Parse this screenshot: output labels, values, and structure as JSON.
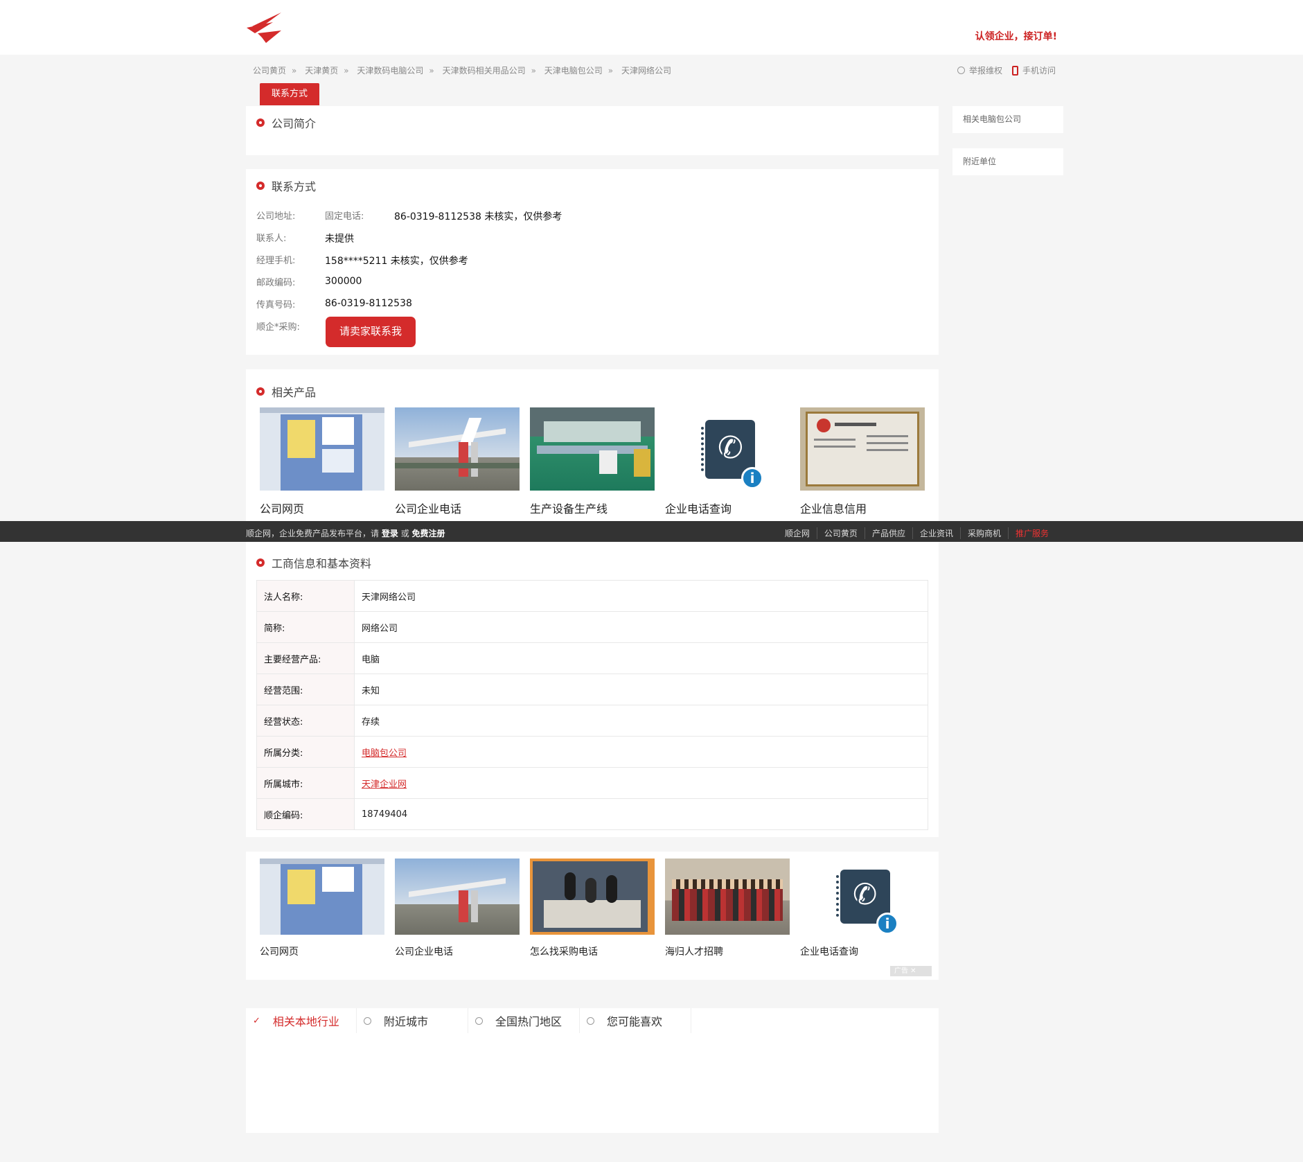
{
  "header": {
    "claim_text": "认领企业，接订单!"
  },
  "breadcrumb": [
    "公司黄页",
    "天津黄页",
    "天津数码电脑公司",
    "天津数码相关用品公司",
    "天津电脑包公司",
    "天津网络公司"
  ],
  "tools": {
    "report": "举报维权",
    "mobile": "手机访问"
  },
  "tab_active": "联系方式",
  "intro": {
    "title": "公司简介"
  },
  "sidebar": {
    "related": "相关电脑包公司",
    "nearby": "附近单位"
  },
  "contact": {
    "title": "联系方式",
    "address_label": "公司地址:",
    "phone_label": "固定电话:",
    "phone_value": "86-0319-8112538 未核实，仅供参考",
    "person_label": "联系人:",
    "person_value": "未提供",
    "mobile_label": "经理手机:",
    "mobile_value": "158****5211 未核实，仅供参考",
    "zip_label": "邮政编码:",
    "zip_value": "300000",
    "fax_label": "传真号码:",
    "fax_value": "86-0319-8112538",
    "purchase_label": "顺企*采购:",
    "contact_button": "请卖家联系我"
  },
  "products": {
    "title": "相关产品",
    "items": [
      "公司网页",
      "公司企业电话",
      "生产设备生产线",
      "企业电话查询",
      "企业信息信用"
    ]
  },
  "footbar": {
    "left_prefix": "顺企网，企业免费产品发布平台，请",
    "login": "登录",
    "or": "或",
    "register": "免费注册",
    "links": [
      "顺企网",
      "公司黄页",
      "产品供应",
      "企业资讯",
      "采购商机",
      "推广服务"
    ]
  },
  "business": {
    "title": "工商信息和基本资料",
    "rows": [
      {
        "k": "法人名称:",
        "v": "天津网络公司"
      },
      {
        "k": "简称:",
        "v": "网络公司"
      },
      {
        "k": "主要经营产品:",
        "v": "电脑"
      },
      {
        "k": "经营范围:",
        "v": "未知"
      },
      {
        "k": "经营状态:",
        "v": "存续"
      },
      {
        "k": "所属分类:",
        "v": "电脑包公司"
      },
      {
        "k": "所属城市:",
        "v": "天津企业网"
      },
      {
        "k": "顺企编码:",
        "v": "18749404"
      }
    ]
  },
  "ads": {
    "items": [
      "公司网页",
      "公司企业电话",
      "怎么找采购电话",
      "海归人才招聘",
      "企业电话查询"
    ],
    "ad_label": "广告"
  },
  "bottom_tabs": [
    "相关本地行业",
    "附近城市",
    "全国热门地区",
    "您可能喜欢"
  ]
}
